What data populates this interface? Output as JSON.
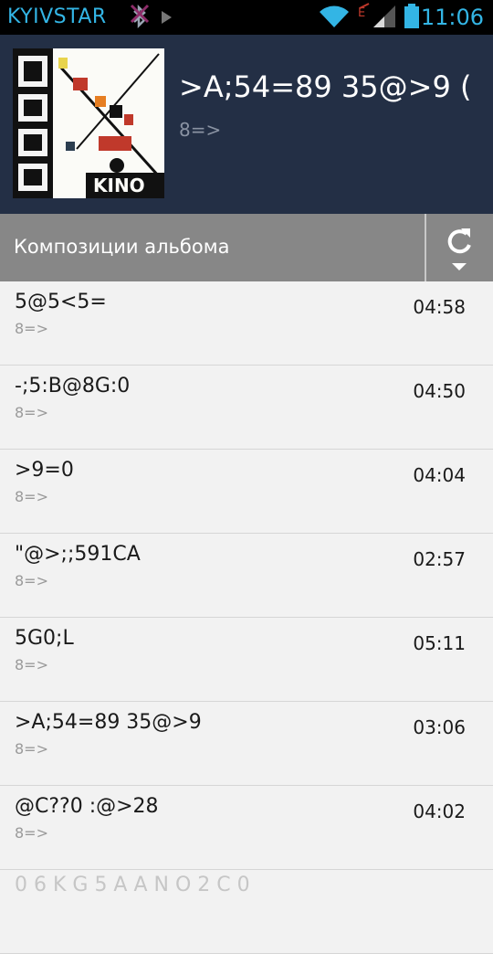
{
  "status_bar": {
    "carrier": "KYIVSTAR",
    "time": "11:06",
    "icons": [
      "bluetooth-disabled-icon",
      "play-store-icon",
      "wifi-icon",
      "data-icon",
      "signal-icon",
      "battery-icon"
    ]
  },
  "album": {
    "title": ">A;54=89 35@>9 (",
    "artist": "8=>",
    "cover_text": "KINO"
  },
  "section": {
    "title": "Композиции альбома",
    "action_icon": "refresh-icon"
  },
  "tracks": [
    {
      "title": "5@5<5=",
      "artist": "8=>",
      "duration": "04:58"
    },
    {
      "title": "-;5:B@8G:0",
      "artist": "8=>",
      "duration": "04:50"
    },
    {
      "title": ">9=0",
      "artist": "8=>",
      "duration": "04:04"
    },
    {
      "title": "\"@>;;591CA",
      "artist": "8=>",
      "duration": "02:57"
    },
    {
      "title": "5G0;L",
      "artist": "8=>",
      "duration": "05:11"
    },
    {
      "title": ">A;54=89 35@>9",
      "artist": "8=>",
      "duration": "03:06"
    },
    {
      "title": "@C??0 :@>28",
      "artist": "8=>",
      "duration": "04:02"
    },
    {
      "title": "0 6 K G 5 A A N O 2 C 0",
      "artist": "",
      "duration": ""
    }
  ],
  "colors": {
    "accent": "#33b5e5",
    "header_bg": "#232f45",
    "section_bg": "#878787",
    "list_bg": "#f2f2f2"
  }
}
